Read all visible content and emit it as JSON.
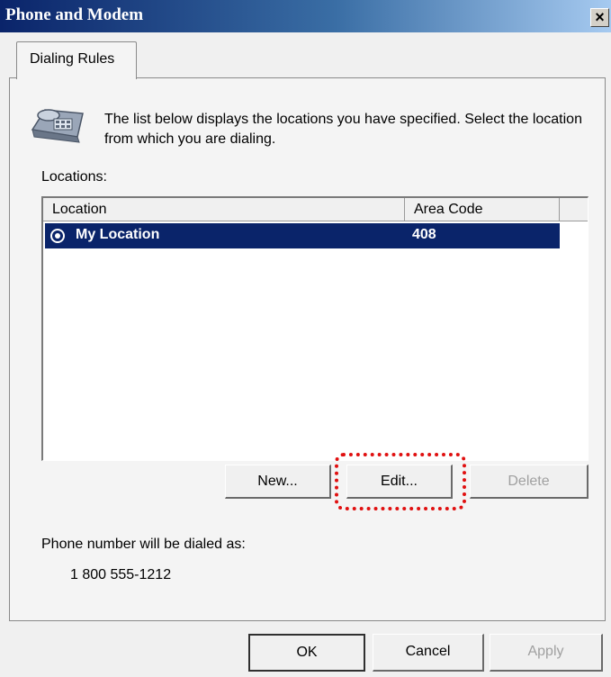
{
  "window": {
    "title": "Phone and Modem",
    "close_label": "×"
  },
  "tabs": [
    {
      "label": "Dialing Rules"
    }
  ],
  "content": {
    "description": "The list below displays the locations you have specified. Select the location from which you are dialing.",
    "locations_label": "Locations:",
    "icon": "telephone-icon"
  },
  "locations_list": {
    "columns": [
      "Location",
      "Area Code"
    ],
    "rows": [
      {
        "location": "My Location",
        "area_code": "408",
        "selected": true
      }
    ]
  },
  "list_buttons": {
    "new_label": "New...",
    "edit_label": "Edit...",
    "delete_label": "Delete"
  },
  "dialing": {
    "label": "Phone number will be dialed as:",
    "number": "1 800 555-1212"
  },
  "dialog_buttons": {
    "ok_label": "OK",
    "cancel_label": "Cancel",
    "apply_label": "Apply"
  },
  "colors": {
    "selection": "#0a246a",
    "highlight": "#e01010"
  }
}
